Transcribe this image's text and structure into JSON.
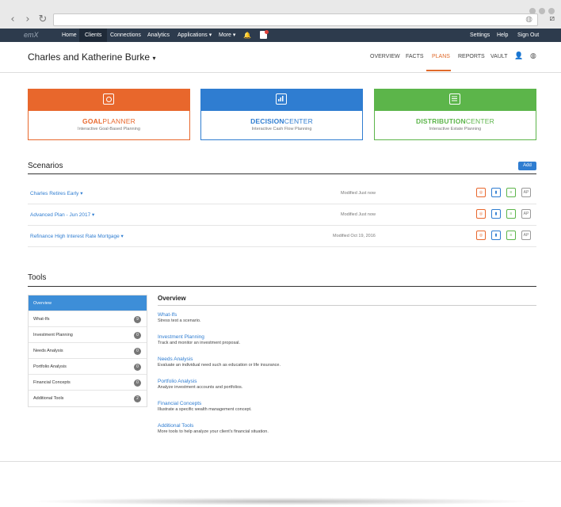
{
  "browser": {
    "back_icon": "chevron-left",
    "forward_icon": "chevron-right",
    "reload_icon": "reload",
    "url": "",
    "globe_icon": "globe",
    "extension_icon": "extension"
  },
  "appnav": {
    "logo": "emX",
    "items": [
      "Home",
      "Clients",
      "Connections",
      "Analytics",
      "Applications ▾",
      "More ▾"
    ],
    "active_item": "Clients",
    "right_items": [
      "Settings",
      "Help",
      "Sign Out"
    ]
  },
  "client": {
    "name": "Charles and Katherine Burke",
    "caret": "▾",
    "tabs": [
      "OVERVIEW",
      "FACTS",
      "PLANS",
      "REPORTS",
      "VAULT"
    ],
    "active_tab": "PLANS"
  },
  "cards": [
    {
      "title_bold": "GOAL",
      "title_light": "PLANNER",
      "subtitle": "Interactive Goal-Based Planning",
      "color": "#e8672c"
    },
    {
      "title_bold": "DECISION",
      "title_light": "CENTER",
      "subtitle": "Interactive Cash Flow Planning",
      "color": "#2f7dd1"
    },
    {
      "title_bold": "DISTRIBUTION",
      "title_light": "CENTER",
      "subtitle": "Interactive Estate Planning",
      "color": "#5cb54a"
    }
  ],
  "scenarios": {
    "title": "Scenarios",
    "add_label": "Add",
    "rows": [
      {
        "name": "Charles Retires Early ▾",
        "modified": "Modified Just now"
      },
      {
        "name": "Advanced Plan - Jun 2017 ▾",
        "modified": "Modified Just now"
      },
      {
        "name": "Refinance High Interest Rate Mortgage ▾",
        "modified": "Modified Oct 19, 2016"
      }
    ],
    "row_icon_ap": "AP"
  },
  "tools": {
    "title": "Tools",
    "menu": [
      {
        "label": "Overview",
        "count": ""
      },
      {
        "label": "What-Ifs",
        "count": "9"
      },
      {
        "label": "Investment Planning",
        "count": "0"
      },
      {
        "label": "Needs Analysis",
        "count": "0"
      },
      {
        "label": "Portfolio Analysis",
        "count": "0"
      },
      {
        "label": "Financial Concepts",
        "count": "0"
      },
      {
        "label": "Additional Tools",
        "count": "2"
      }
    ],
    "overview_title": "Overview",
    "overview_items": [
      {
        "link": "What-Ifs",
        "desc": "Stress test a scenario."
      },
      {
        "link": "Investment Planning",
        "desc": "Track and monitor an investment proposal."
      },
      {
        "link": "Needs Analysis",
        "desc": "Evaluate an individual need such as education or life insurance."
      },
      {
        "link": "Portfolio Analysis",
        "desc": "Analyze investment accounts and portfolios."
      },
      {
        "link": "Financial Concepts",
        "desc": "Illustrate a specific wealth management concept."
      },
      {
        "link": "Additional Tools",
        "desc": "More tools to help analyze your client's financial situation."
      }
    ]
  }
}
